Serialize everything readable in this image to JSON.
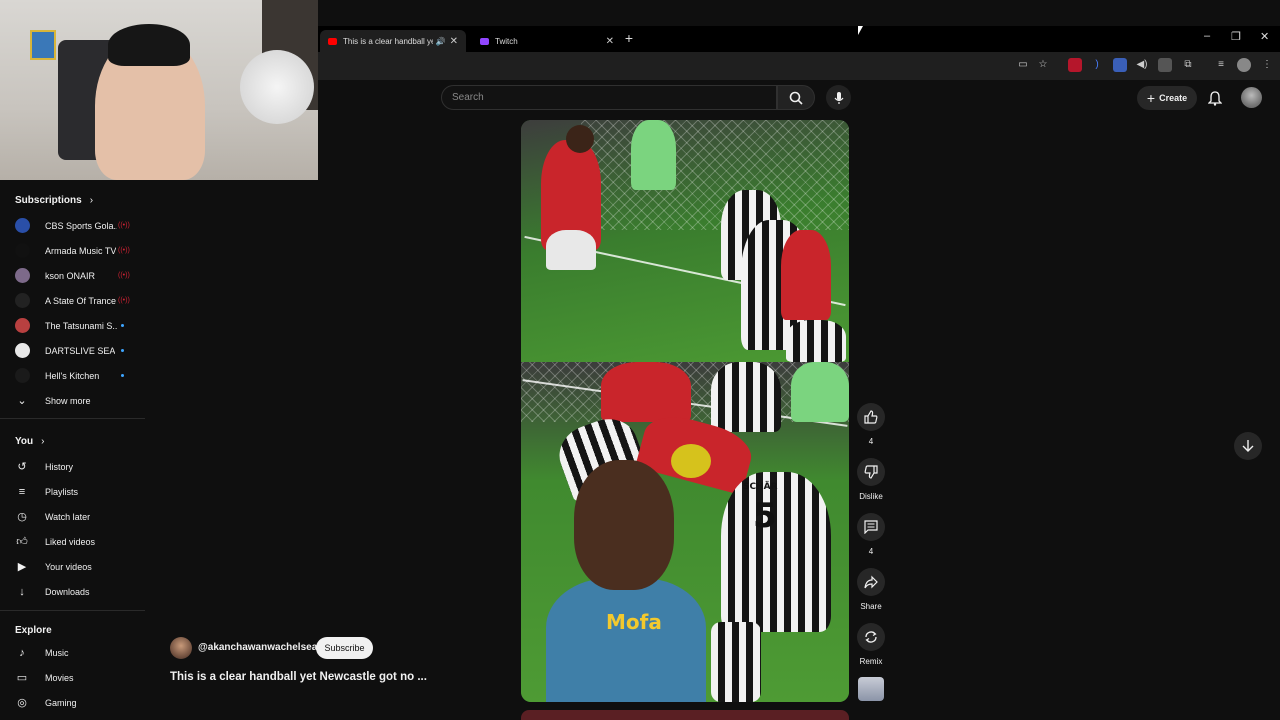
{
  "browser": {
    "tabs": [
      {
        "title": "This is a clear handball yet",
        "active": true,
        "favicon": "youtube-icon"
      },
      {
        "title": "Twitch",
        "active": false,
        "favicon": "twitch-icon"
      }
    ],
    "new_tab": "+",
    "window_controls": [
      "–",
      "❐",
      "✕"
    ]
  },
  "header": {
    "search_placeholder": "Search",
    "create_label": "Create"
  },
  "sidebar": {
    "subscriptions_title": "Subscriptions",
    "subscriptions": [
      {
        "label": "CBS Sports Gola...",
        "badge": "live",
        "avatar_color": "#2a4fa8"
      },
      {
        "label": "Armada Music TV",
        "badge": "live",
        "avatar_color": "#111111"
      },
      {
        "label": "kson ONAIR",
        "badge": "live",
        "avatar_color": "#7d6a8a"
      },
      {
        "label": "A State Of Trance",
        "badge": "live",
        "avatar_color": "#222222"
      },
      {
        "label": "The Tatsunami S...",
        "badge": "dot",
        "avatar_color": "#b84040"
      },
      {
        "label": "DARTSLIVE SEA",
        "badge": "dot",
        "avatar_color": "#e8e8e8"
      },
      {
        "label": "Hell's Kitchen",
        "badge": "dot",
        "avatar_color": "#1a1a1a"
      }
    ],
    "show_more": "Show more",
    "you_title": "You",
    "you_items": [
      {
        "label": "History",
        "icon": "history-icon"
      },
      {
        "label": "Playlists",
        "icon": "playlists-icon"
      },
      {
        "label": "Watch later",
        "icon": "watch-later-icon"
      },
      {
        "label": "Liked videos",
        "icon": "like-icon"
      },
      {
        "label": "Your videos",
        "icon": "your-videos-icon"
      },
      {
        "label": "Downloads",
        "icon": "download-icon"
      }
    ],
    "explore_title": "Explore",
    "explore_items": [
      {
        "label": "Music",
        "icon": "music-icon"
      },
      {
        "label": "Movies",
        "icon": "movies-icon"
      },
      {
        "label": "Gaming",
        "icon": "gaming-icon"
      }
    ]
  },
  "short": {
    "channel": "@akanchawanwachelsea",
    "subscribe_label": "Subscribe",
    "title": "This is a clear handball yet Newcastle got no ...",
    "shirt_number": "5",
    "shirt_name": "SCHÄR",
    "actions": {
      "like_count": "4",
      "dislike_label": "Dislike",
      "comment_count": "4",
      "share_label": "Share",
      "remix_label": "Remix"
    }
  },
  "colors": {
    "background": "#0f0f0f",
    "live_badge": "#cc2233",
    "new_dot": "#3ea6ff"
  }
}
